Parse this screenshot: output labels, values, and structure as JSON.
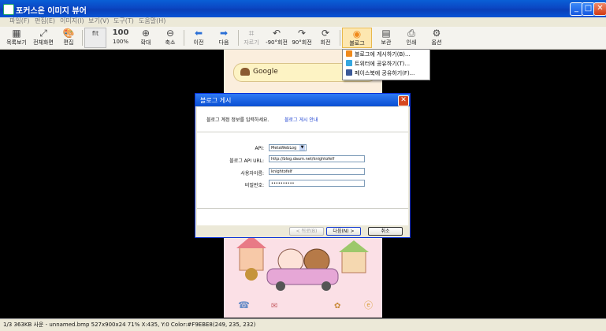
{
  "window": {
    "title": "포커스온 이미지 뷰어"
  },
  "menu": [
    "파일(F)",
    "편집(E)",
    "이미지(I)",
    "보기(V)",
    "도구(T)",
    "도움말(H)"
  ],
  "toolbar": {
    "list": "목록보기",
    "fullscreen": "전체화면",
    "edit": "편집",
    "fit": "fit",
    "hundred_icon": "100",
    "hundred": "100%",
    "zoom_in": "확대",
    "zoom_out": "축소",
    "prev": "이전",
    "next": "다음",
    "crop": "자르기",
    "rot_l": "-90°회전",
    "rot_r": "90°회전",
    "rotate": "회전",
    "blog": "블로그",
    "save": "보관",
    "print": "인쇄",
    "options": "옵션"
  },
  "share_menu": [
    {
      "label": "블로그에 게시하기(B)...",
      "color": "#f08a1c"
    },
    {
      "label": "트위터에 공유하기(T)...",
      "color": "#35a7e0"
    },
    {
      "label": "페이스북에 공유하기(F)...",
      "color": "#3b5998"
    }
  ],
  "image": {
    "search_text": "Google"
  },
  "dialog": {
    "title": "블로그 게시",
    "intro": "블로그 계정 정보를 입력하세요.",
    "guide_link": "블로그 게시 안내",
    "api_label": "API:",
    "api_value": "MetaWebLog",
    "url_label": "블로그 API URL:",
    "url_value": "http://blog.daum.net/knightofelf",
    "user_label": "사용자이름:",
    "user_value": "knightofelf",
    "pw_label": "비밀번호:",
    "pw_value": "••••••••••",
    "back": "< 뒤로(B)",
    "next": "다음(N) >",
    "cancel": "취소"
  },
  "status": "1/3  363KB  사운  - unnamed.bmp  527x900x24  71%  X:435, Y:0 Color:#F9EBE8(249, 235, 232)"
}
